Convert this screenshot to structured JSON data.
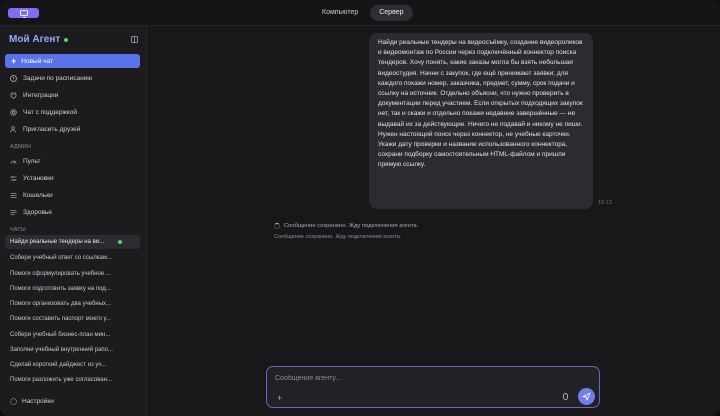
{
  "topbar": {
    "logo_icon": "monitor-icon",
    "tabs": [
      {
        "label": "Компьютер",
        "active": false
      },
      {
        "label": "Сервер",
        "active": true
      }
    ]
  },
  "sidebar": {
    "brand": "Мой Агент",
    "new_chat_label": "Новый чат",
    "primary_items": [
      {
        "label": "Задачи по расписанию",
        "icon": "clock-icon"
      },
      {
        "label": "Интеграции",
        "icon": "plug-icon"
      },
      {
        "label": "Чат с поддержкой",
        "icon": "support-icon"
      },
      {
        "label": "Пригласить друзей",
        "icon": "user-add-icon"
      }
    ],
    "admin_label": "АДМИН",
    "admin_items": [
      {
        "label": "Пульт",
        "icon": "dashboard-icon"
      },
      {
        "label": "Установки",
        "icon": "sliders-icon"
      },
      {
        "label": "Кошельки",
        "icon": "wallet-icon"
      },
      {
        "label": "Здоровье",
        "icon": "health-icon"
      }
    ],
    "chats_label": "ЧАТЫ",
    "chats": [
      {
        "label": "Найди реальные тендеры на ви...",
        "active": true
      },
      {
        "label": "Собери учебный ответ со ссылкам...",
        "active": false
      },
      {
        "label": "Помоги сформулировать учебное ...",
        "active": false
      },
      {
        "label": "Помоги подготовить заявку на под...",
        "active": false
      },
      {
        "label": "Помоги организовать два учебных...",
        "active": false
      },
      {
        "label": "Помоги составить паспорт моего у...",
        "active": false
      },
      {
        "label": "Собери учебный бизнес-план мин...",
        "active": false
      },
      {
        "label": "Заполни учебный внутренний рапо...",
        "active": false
      },
      {
        "label": "Сделай короткий дайджест из уч...",
        "active": false
      },
      {
        "label": "Помоги разложить уже согласован...",
        "active": false
      }
    ],
    "settings_label": "Настройки"
  },
  "conversation": {
    "user_message": "Найди реальные тендеры на видеосъёмку, создание видеороликов и видеомонтаж по России через подключённый коннектор поиска тендеров. Хочу понять, какие заказы могла бы взять небольшая видеостудия. Начни с закупок, где ещё принимают заявки; для каждого покажи номер, заказчика, предмет, сумму, срок подачи и ссылку на источник. Отдельно объясни, что нужно проверить в документации перед участием. Если открытых подходящих закупок нет, так и скажи и отдельно покажи недавние завершённые — не выдавай их за действующие. Ничего не подавай и никому не пиши. Нужен настоящий поиск через коннектор, не учебные карточки. Укажи дату проверки и название использованного коннектора, сохрани подборку самостоятельным HTML-файлом и пришли прямую ссылку.",
    "message_time": "10:13",
    "status_line": "Сообщение сохранено. Жду подключения агента.",
    "status_sub": "Сообщение сохранено. Жду подключения агента."
  },
  "composer": {
    "placeholder": "Сообщение агенту..."
  },
  "colors": {
    "accent": "#5b73e8",
    "brand_text": "#9aa8ff",
    "online_dot": "#4cd471",
    "send_button": "#6f7ee8",
    "composer_border": "#6b63c4"
  }
}
